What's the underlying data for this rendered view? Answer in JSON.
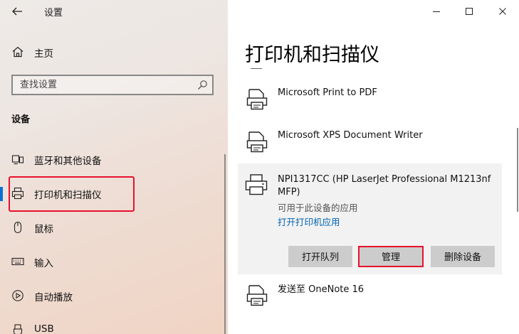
{
  "window": {
    "title": "设置",
    "controls": [
      "minimize",
      "maximize",
      "close"
    ]
  },
  "nav": {
    "home_label": "主页",
    "search_placeholder": "查找设置",
    "section_title": "设备",
    "items": [
      {
        "label": "蓝牙和其他设备",
        "icon": "bluetooth-devices-icon",
        "selected": false
      },
      {
        "label": "打印机和扫描仪",
        "icon": "printer-icon",
        "selected": true
      },
      {
        "label": "鼠标",
        "icon": "mouse-icon",
        "selected": false
      },
      {
        "label": "输入",
        "icon": "keyboard-icon",
        "selected": false
      },
      {
        "label": "自动播放",
        "icon": "autoplay-icon",
        "selected": false
      },
      {
        "label": "USB",
        "icon": "usb-icon",
        "selected": false
      }
    ]
  },
  "content": {
    "page_title": "打印机和扫描仪",
    "devices": [
      {
        "name": "Microsoft Print to PDF",
        "icon": "printer-document-icon"
      },
      {
        "name": "Microsoft XPS Document Writer",
        "icon": "printer-document-icon"
      },
      {
        "name": "NPI1317CC (HP LaserJet Professional M1213nf MFP)",
        "icon": "printer-icon",
        "expanded": true,
        "status": "可用于此设备的应用",
        "app_link": "打开打印机应用",
        "buttons": {
          "open_queue": "打开队列",
          "manage": "管理",
          "remove": "删除设备"
        }
      },
      {
        "name": "发送至 OneNote 16",
        "icon": "printer-document-icon"
      }
    ]
  },
  "colors": {
    "accent": "#0063b1",
    "selection_bar": "#0b6fd4",
    "highlight_red": "#e8112d",
    "button_bg": "#cccccc",
    "expanded_bg": "#f2f2f2"
  }
}
